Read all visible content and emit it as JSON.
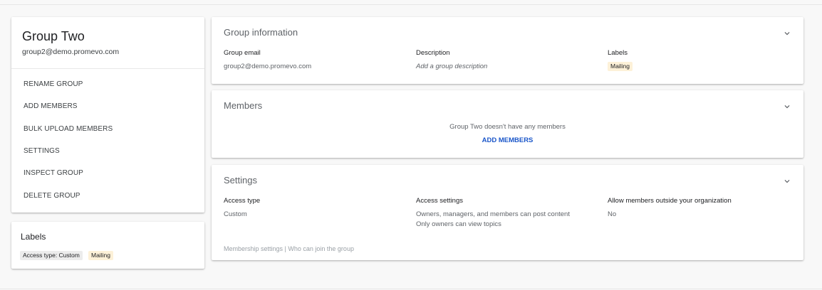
{
  "group": {
    "name": "Group Two",
    "email": "group2@demo.promevo.com",
    "actions": [
      {
        "label": "RENAME GROUP"
      },
      {
        "label": "ADD MEMBERS"
      },
      {
        "label": "BULK UPLOAD MEMBERS"
      },
      {
        "label": "SETTINGS"
      },
      {
        "label": "INSPECT GROUP"
      },
      {
        "label": "DELETE GROUP"
      }
    ]
  },
  "labels_card": {
    "title": "Labels",
    "chips": [
      {
        "label": "Access type: Custom",
        "color": "#ececec"
      },
      {
        "label": "Mailing",
        "color": "#fdf1d8"
      }
    ]
  },
  "group_information": {
    "title": "Group information",
    "email_label": "Group email",
    "email_value": "group2@demo.promevo.com",
    "description_label": "Description",
    "description_placeholder": "Add a group description",
    "labels_label": "Labels",
    "labels_chip": "Mailing"
  },
  "members": {
    "title": "Members",
    "empty_message": "Group Two doesn't have any members",
    "add_link": "ADD MEMBERS"
  },
  "settings": {
    "title": "Settings",
    "access_type_label": "Access type",
    "access_type_value": "Custom",
    "access_settings_label": "Access settings",
    "access_settings_line1": "Owners, managers, and members can post content",
    "access_settings_line2": "Only owners can view topics",
    "outside_label": "Allow members outside your organization",
    "outside_value": "No",
    "membership_link": "Membership settings",
    "separator": " | ",
    "join_link": "Who can join the group"
  },
  "colors": {
    "link_blue": "#1a56c9",
    "chip_yellow": "#fdf1d8",
    "chip_grey": "#ececec"
  },
  "icons": {
    "expand": "chevron-down-icon"
  }
}
